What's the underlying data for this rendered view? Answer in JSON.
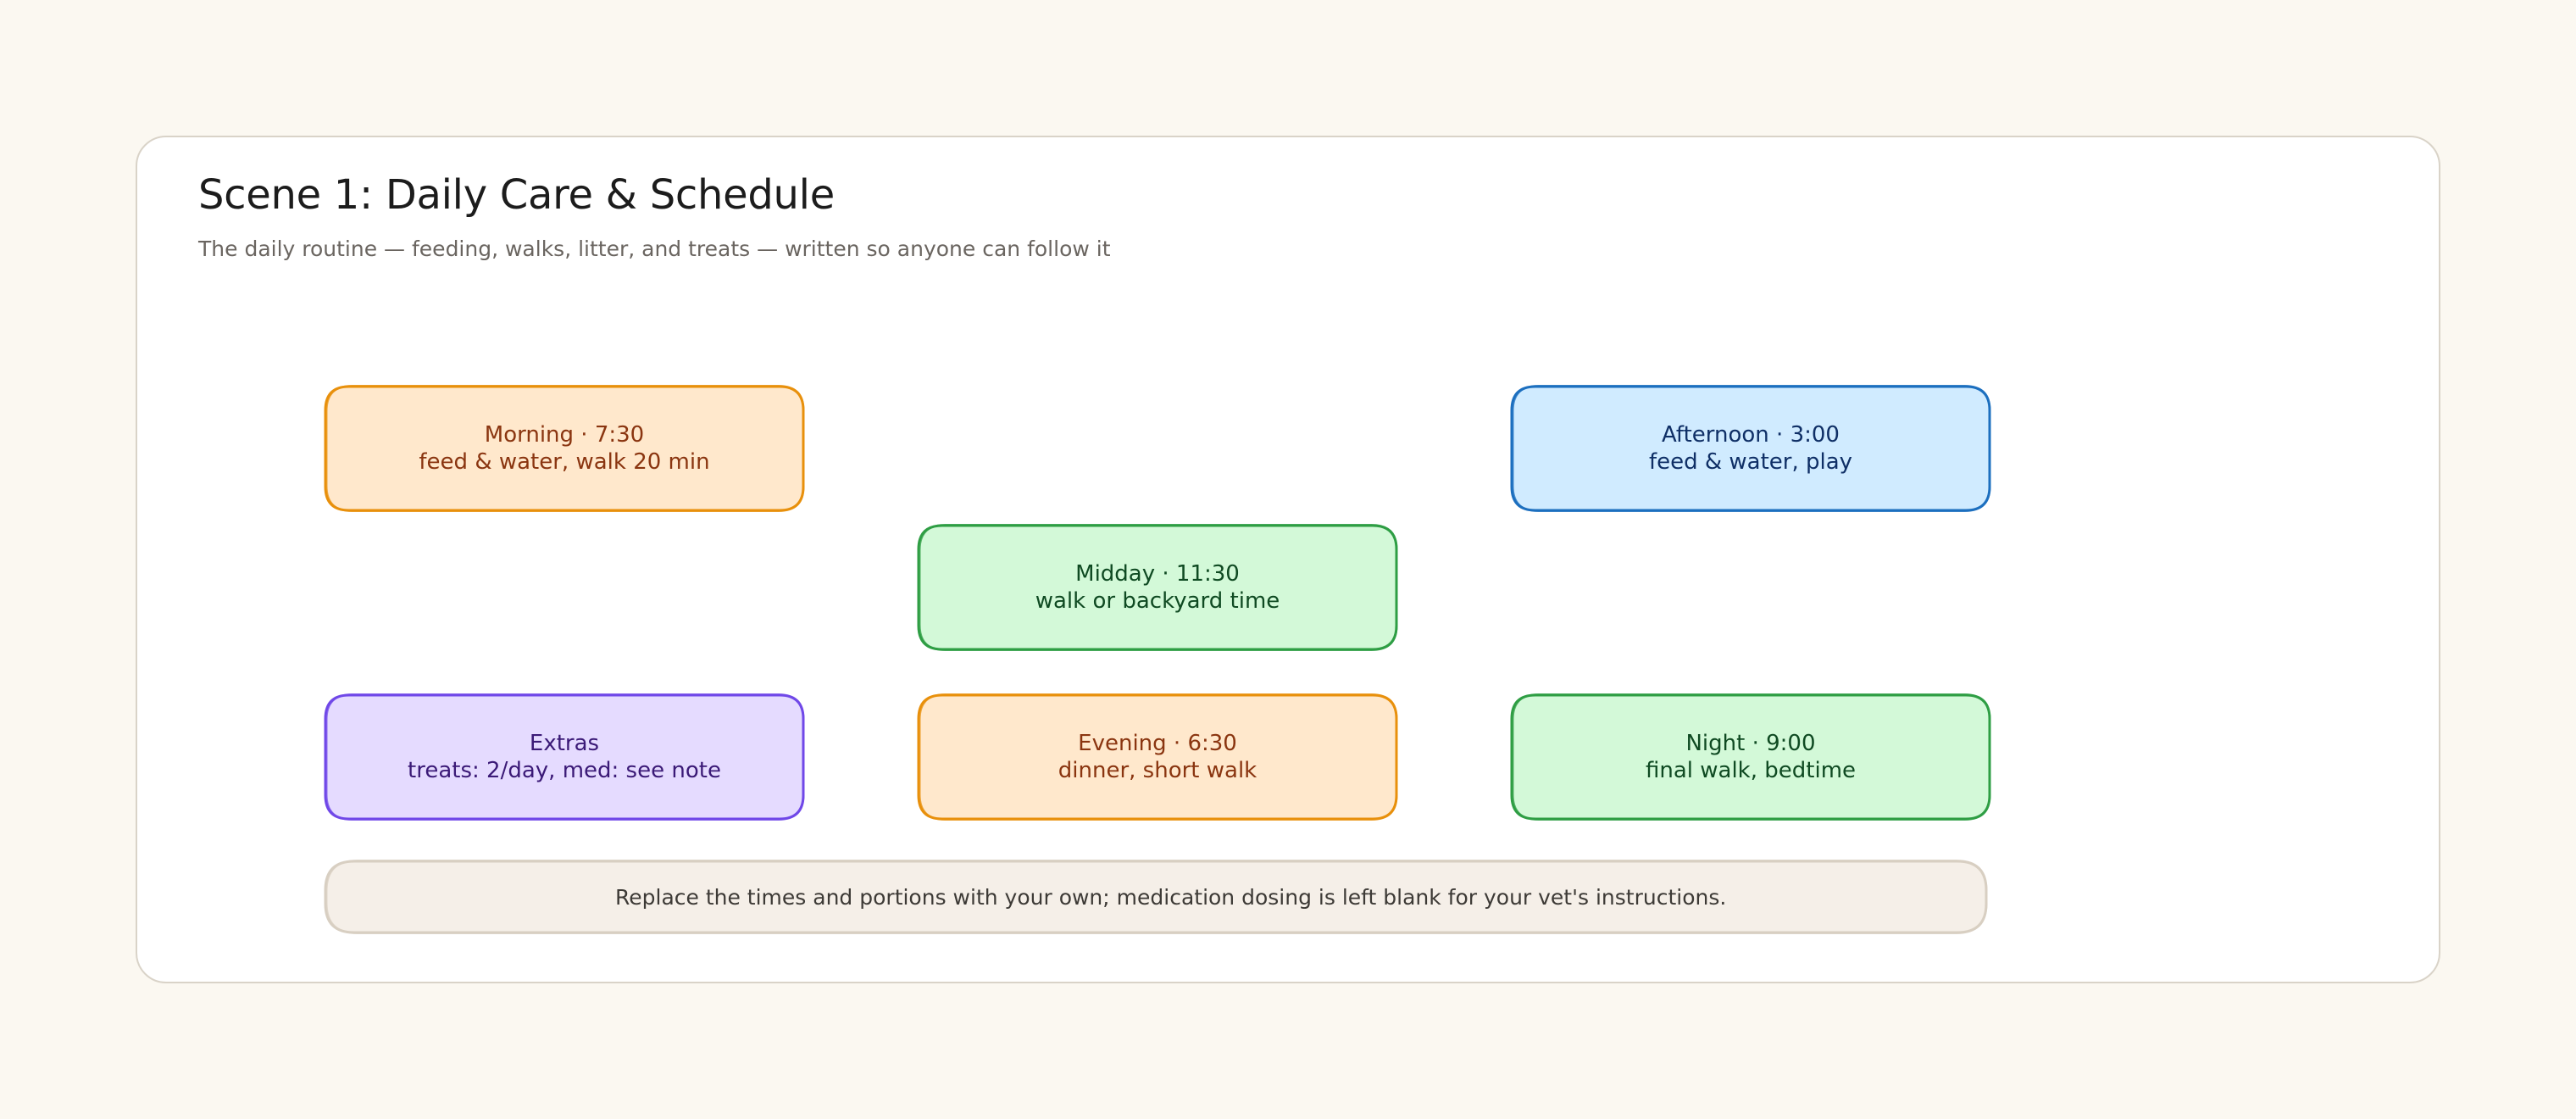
{
  "scene": {
    "title": "Scene 1: Daily Care & Schedule",
    "subtitle": "The daily routine — feeding, walks, litter, and treats — written so anyone can follow it"
  },
  "nodes": [
    {
      "id": "morning",
      "line1": "Morning · 7:30",
      "line2": "feed & water, walk 20 min",
      "fill": "#ffe8cc",
      "stroke": "#e8900c",
      "text": "#8a3510"
    },
    {
      "id": "afternoon",
      "line1": "Afternoon · 3:00",
      "line2": "feed & water, play",
      "fill": "#d0ebff",
      "stroke": "#1c6fbf",
      "text": "#0f2f66"
    },
    {
      "id": "midday",
      "line1": "Midday · 11:30",
      "line2": "walk or backyard time",
      "fill": "#d3f9d8",
      "stroke": "#2f9e44",
      "text": "#0f4a22"
    },
    {
      "id": "extras",
      "line1": "Extras",
      "line2": "treats: 2/day, med: see note",
      "fill": "#e5dbff",
      "stroke": "#7048e8",
      "text": "#3b1a77"
    },
    {
      "id": "evening",
      "line1": "Evening · 6:30",
      "line2": "dinner, short walk",
      "fill": "#ffe8cc",
      "stroke": "#e8900c",
      "text": "#8a3510"
    },
    {
      "id": "night",
      "line1": "Night · 9:00",
      "line2": "final walk, bedtime",
      "fill": "#d3f9d8",
      "stroke": "#2f9e44",
      "text": "#0f4a22"
    }
  ],
  "note": {
    "text": "Replace the times and portions with your own; medication dosing is left blank for your vet's instructions.",
    "fill": "#f5efe8",
    "stroke": "#d8cfc2"
  }
}
